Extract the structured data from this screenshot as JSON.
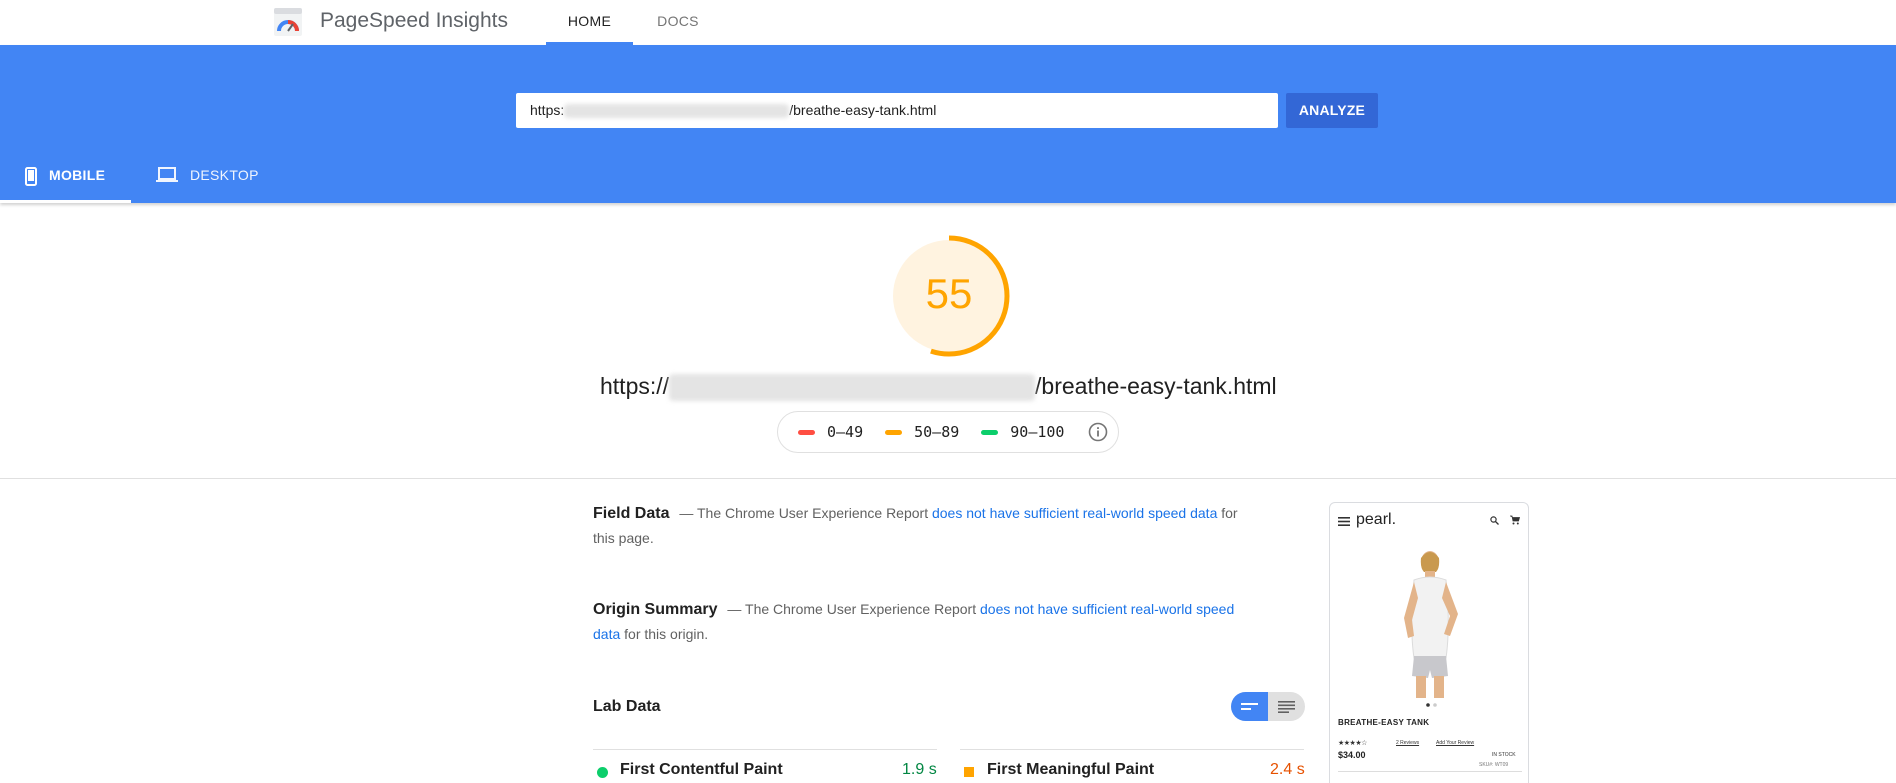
{
  "header": {
    "app_title": "PageSpeed Insights",
    "nav": [
      {
        "label": "HOME",
        "active": true
      },
      {
        "label": "DOCS",
        "active": false
      }
    ]
  },
  "search": {
    "url_prefix": "https:",
    "url_suffix": "/breathe-easy-tank.html",
    "analyze_label": "ANALYZE"
  },
  "device_tabs": [
    {
      "label": "MOBILE",
      "active": true,
      "icon": "phone-icon"
    },
    {
      "label": "DESKTOP",
      "active": false,
      "icon": "laptop-icon"
    }
  ],
  "score": {
    "value": "55",
    "fraction": 0.55,
    "color": "#ffa400"
  },
  "page_url": {
    "prefix": "https://",
    "suffix": "/breathe-easy-tank.html"
  },
  "legend": [
    {
      "label": "0–49",
      "color": "#ff4e42"
    },
    {
      "label": "50–89",
      "color": "#ffa400"
    },
    {
      "label": "90–100",
      "color": "#0cce6b"
    }
  ],
  "field_data": {
    "heading": "Field Data",
    "text_before": "— The Chrome User Experience Report",
    "link": "does not have sufficient real-world speed data",
    "text_after": "for this page."
  },
  "origin_summary": {
    "heading": "Origin Summary",
    "text_before": "— The Chrome User Experience Report",
    "link": "does not have sufficient real-world speed data",
    "text_after": "for this origin."
  },
  "lab_data": {
    "heading": "Lab Data",
    "metrics": [
      {
        "name": "First Contentful Paint",
        "value": "1.9 s",
        "color": "#018642"
      },
      {
        "name": "First Meaningful Paint",
        "value": "2.4 s",
        "color": "#e65100"
      }
    ]
  },
  "preview": {
    "brand": "pearl.",
    "product_name": "BREATHE-EASY TANK",
    "reviews": "2 Reviews",
    "add_review": "Add Your Review",
    "price": "$34.00",
    "stock": "IN STOCK",
    "sku": "SKU#: WT09",
    "rating": 3.5
  }
}
